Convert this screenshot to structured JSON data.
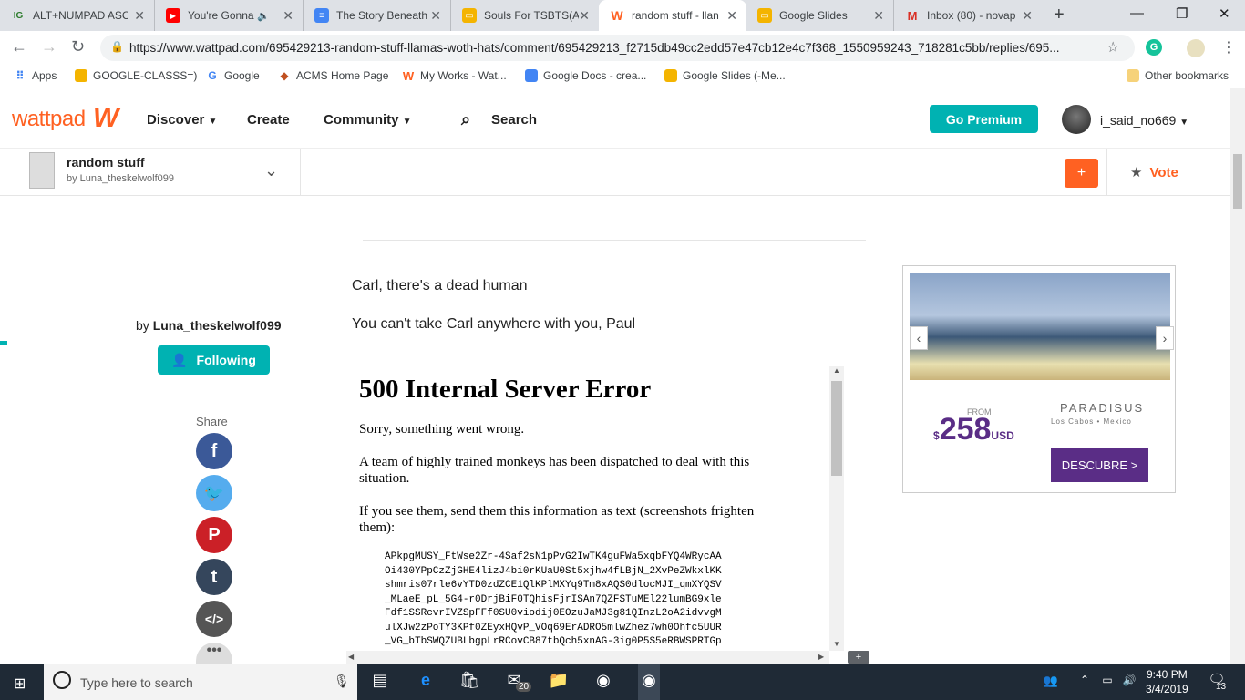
{
  "tabs": [
    {
      "title": "ALT+NUMPAD ASC",
      "fav": "IG",
      "favcolor": "#2a7a2a"
    },
    {
      "title": "You're Gonna",
      "fav": "▶",
      "favcolor": "#ff0000"
    },
    {
      "title": "The Story Beneath",
      "fav": "≡",
      "favcolor": "#4285f4"
    },
    {
      "title": "Souls For TSBTS(A",
      "fav": "▭",
      "favcolor": "#f4b400"
    },
    {
      "title": "random stuff - llan",
      "fav": "W",
      "favcolor": "#ff6122"
    },
    {
      "title": "Google Slides",
      "fav": "▭",
      "favcolor": "#f4b400"
    },
    {
      "title": "Inbox (80) - novap",
      "fav": "M",
      "favcolor": "#d93025"
    }
  ],
  "url": "https://www.wattpad.com/695429213-random-stuff-llamas-woth-hats/comment/695429213_f2715db49cc2edd57e47cb12e4c7f368_1550959243_718281c5bb/replies/695...",
  "bookmarks": [
    {
      "label": "Apps"
    },
    {
      "label": "GOOGLE-CLASSS=)"
    },
    {
      "label": "Google"
    },
    {
      "label": "ACMS Home Page"
    },
    {
      "label": "My Works - Wat..."
    },
    {
      "label": "Google Docs - crea..."
    },
    {
      "label": "Google Slides (-Me..."
    },
    {
      "label": "Other bookmarks"
    }
  ],
  "header": {
    "logo": "wattpad",
    "nav": {
      "discover": "Discover",
      "create": "Create",
      "community": "Community",
      "search": "Search"
    },
    "premium": "Go Premium",
    "username": "i_said_no669"
  },
  "story": {
    "title": "random stuff",
    "by": "by Luna_theskelwolf099",
    "vote": "Vote"
  },
  "author": {
    "by_prefix": "by ",
    "name": "Luna_theskelwolf099",
    "follow": "Following",
    "share": "Share"
  },
  "content": {
    "p1": "Carl, there's a dead human",
    "p2": "You can't take Carl anywhere with you, Paul"
  },
  "error": {
    "heading": "500 Internal Server Error",
    "p1": "Sorry, something went wrong.",
    "p2": "A team of highly trained monkeys has been dispatched to deal with this situation.",
    "p3": "If you see them, send them this information as text (screenshots frighten them):",
    "code": "APkpgMUSY_FtWse2Zr-4Saf2sN1pPvG2IwTK4guFWa5xqbFYQ4WRycAA\nOi430YPpCzZjGHE4lizJ4bi0rKUaU0St5xjhw4fLBjN_2XvPeZWkxlKK\nshmris07rle6vYTD0zdZCE1QlKPlMXYq9Tm8xAQS0dlocMJI_qmXYQSV\n_MLaeE_pL_5G4-r0DrjBiF0TQhisFjrISAn7QZFSTuMEl22lumBG9xle\nFdf1SSRcvrIVZSpFFf0SU0viodij0EOzuJaMJ3g81QInzL2oA2idvvgM\nulXJw2zPoTY3KPf0ZEyxHQvP_VOq69ErADRO5mlwZhez7wh0Ohfc5UUR\n_VG_bTbSWQZUBLbgpLrRCovCB87tbQch5xnAG-3ig0P5S5eRBWSPRTGp"
  },
  "ad": {
    "from": "FROM",
    "currency": "$",
    "price": "258",
    "unit": "USD",
    "brand": "PARADISUS",
    "sub": "Los Cabos  •  Mexico",
    "cta": "DESCUBRE >"
  },
  "taskbar": {
    "search": "Type here to search",
    "time": "9:40 PM",
    "date": "3/4/2019",
    "mail_count": "20",
    "notif": "13"
  }
}
